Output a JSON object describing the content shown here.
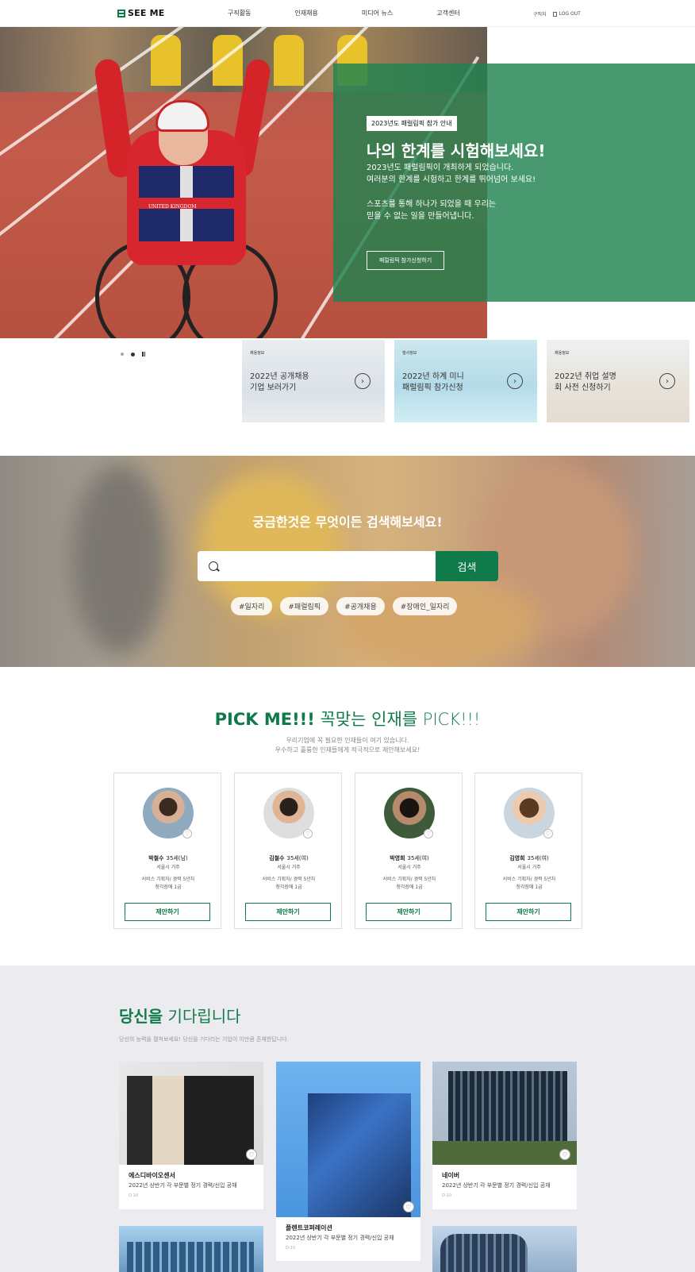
{
  "header": {
    "logo": "SEE ME",
    "nav": [
      "구직활동",
      "인재채용",
      "미디어 뉴스",
      "고객센터"
    ],
    "user_label": "구직자",
    "logout_label": "LOG OUT"
  },
  "hero": {
    "tag": "2023년도 패럴림픽 참가 안내",
    "title": "나의 한계를 시험해보세요!",
    "desc_line1": "2023년도 패럴림픽이 개최하게 되었습니다.",
    "desc_line2": "여러분의 한계를 시험하고 한계를 뛰어넘어 보세요!",
    "desc_line3": "스포츠를 통해 하나가 되었을 때 우리는",
    "desc_line4": "믿을 수 없는 일을 만들어냅니다.",
    "button": "패럴림픽 참가신청하기",
    "jersey_text": "UNITED KINGDOM"
  },
  "promos": [
    {
      "tag": "채용정보",
      "line1": "2022년 공개채용",
      "line2": "기업 보러가기"
    },
    {
      "tag": "행사정보",
      "line1": "2022년 하계 미니",
      "line2": "패럴림픽 참가신청"
    },
    {
      "tag": "채용정보",
      "line1": "2022년 취업 설명",
      "line2": "회 사전 신청하기"
    }
  ],
  "search": {
    "title": "궁금한것은 무엇이든 검색해보세요!",
    "button": "검색",
    "placeholder": "",
    "hashtags": [
      "#일자리",
      "#패럴림픽",
      "#공개채용",
      "#장애인_일자리"
    ]
  },
  "pick": {
    "title_bold": "PICK ME!!!",
    "title_light": " 꼭맞는 인재를 PICK!!!",
    "desc_line1": "우리기업에 꼭 필요한 인재들이 여기 있습니다.",
    "desc_line2": "우수하고 훌륭한 인재들에게 적극적으로 제안해보세요!",
    "candidates": [
      {
        "name": "박철수",
        "info": "35세(남)",
        "location": "서울시 거주",
        "job": "서비스 기획자/ 경력 5년차",
        "grade": "청각장애 1급",
        "button": "제안하기"
      },
      {
        "name": "김철수",
        "info": "35세(여)",
        "location": "서울시 거주",
        "job": "서비스 기획자/ 경력 5년차",
        "grade": "청각장애 1급",
        "button": "제안하기"
      },
      {
        "name": "박영희",
        "info": "35세(여)",
        "location": "서울시 거주",
        "job": "서비스 기획자/ 경력 5년차",
        "grade": "청각장애 1급",
        "button": "제안하기"
      },
      {
        "name": "김영희",
        "info": "35세(여)",
        "location": "서울시 거주",
        "job": "서비스 기획자/ 경력 5년차",
        "grade": "청각장애 1급",
        "button": "제안하기"
      }
    ]
  },
  "waiting": {
    "title_bold": "당신을",
    "title_light": " 기다립니다",
    "desc": "당신의 능력을 펼쳐보세요! 당신을 기다리는 기업이 이만큼 존재한답니다.",
    "companies": [
      {
        "name": "에스디바이오센서",
        "desc": "2022년 상반기 각 부문별 정기 경력/신입 공채",
        "dday": "D-10"
      },
      {
        "name": "플렌트코퍼레이션",
        "desc": "2022년 상반기 각 부문별 정기 경력/신입 공채",
        "dday": "D-10"
      },
      {
        "name": "네이버",
        "desc": "2022년 상반기 각 부문별 정기 경력/신입 공채",
        "dday": "D-10"
      }
    ]
  }
}
